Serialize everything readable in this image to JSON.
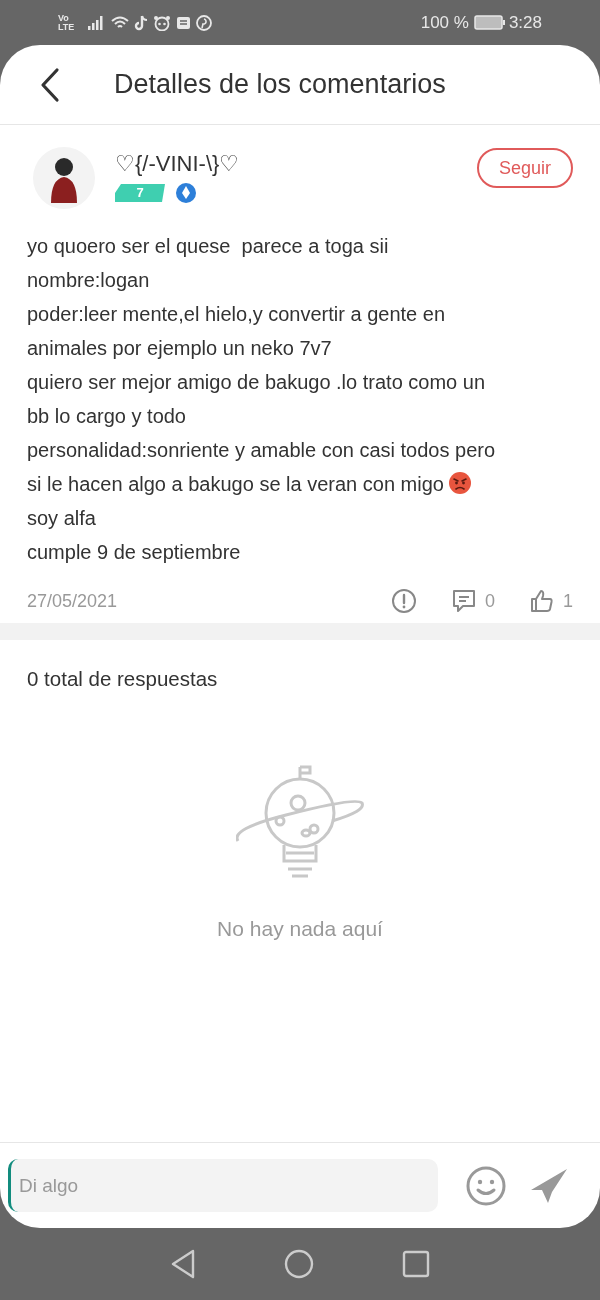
{
  "status_bar": {
    "network": "Vo LTE",
    "battery": "100 %",
    "time": "3:28"
  },
  "header": {
    "title": "Detalles de los comentarios"
  },
  "comment": {
    "author": "♡{/-VINI-\\}♡",
    "level": "7",
    "follow_button": "Seguir",
    "lines": [
      {
        "kind": "text",
        "text": "yo quoero ser el quese  parece a toga sii"
      },
      {
        "kind": "text",
        "text": "nombre:logan"
      },
      {
        "kind": "text",
        "text": "poder:leer mente,el hielo,y convertir a gente en"
      },
      {
        "kind": "text",
        "text": "animales por ejemplo un neko 7v7"
      },
      {
        "kind": "text",
        "text": "quiero ser mejor amigo de bakugo .lo trato como un"
      },
      {
        "kind": "text",
        "text": "bb lo cargo y todo"
      },
      {
        "kind": "text",
        "text": "personalidad:sonriente y amable con casi todos pero"
      },
      {
        "kind": "angry_emoji",
        "text": "si le hacen algo a bakugo se la veran con migo"
      },
      {
        "kind": "text",
        "text": "soy alfa"
      },
      {
        "kind": "text",
        "text": "cumple 9 de septiembre"
      }
    ],
    "date": "27/05/2021",
    "reply_count": "0",
    "like_count": "1"
  },
  "replies": {
    "total": "0 total de respuestas",
    "empty_message": "No hay nada aquí"
  },
  "composer": {
    "placeholder": "Di algo"
  }
}
